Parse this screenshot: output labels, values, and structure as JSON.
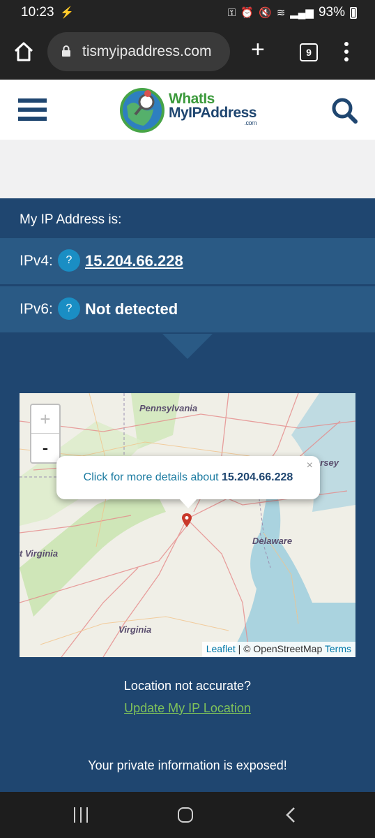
{
  "status": {
    "time": "10:23",
    "battery_pct": "93%"
  },
  "browser": {
    "url": "tismyipaddress.com",
    "tab_count": "9"
  },
  "site": {
    "logo_line1": "WhatIs",
    "logo_line2": "MyIPAddress",
    "logo_line3": ".com"
  },
  "ip": {
    "heading": "My IP Address is:",
    "ipv4_label": "IPv4:",
    "ipv4_value": "15.204.66.228",
    "ipv6_label": "IPv6:",
    "ipv6_value": "Not detected",
    "help_glyph": "?"
  },
  "map": {
    "zoom_in": "+",
    "zoom_out": "-",
    "popup_text": "Click for more details about ",
    "popup_ip": "15.204.66.228",
    "popup_close": "×",
    "labels": {
      "pennsylvania": "Pennsylvania",
      "jersey": "ersey",
      "delaware": "Delaware",
      "west_virginia": "t Virginia",
      "virginia": "Virginia"
    },
    "attribution": {
      "leaflet": "Leaflet",
      "separator": " | © OpenStreetMap ",
      "terms": "Terms"
    }
  },
  "location": {
    "question": "Location not accurate?",
    "update_link": "Update My IP Location",
    "warning": "Your private information is exposed!"
  },
  "colors": {
    "brand_blue": "#1f4670",
    "row_blue": "#2a5a85",
    "help_blue": "#1a8ec4",
    "link_green": "#7fc25a"
  },
  "icons": [
    "home-icon",
    "lock-icon",
    "plus-icon",
    "tabs-icon",
    "more-vert-icon",
    "hamburger-icon",
    "search-icon",
    "map-marker-icon",
    "recent-apps-icon",
    "home-nav-icon",
    "back-icon"
  ]
}
